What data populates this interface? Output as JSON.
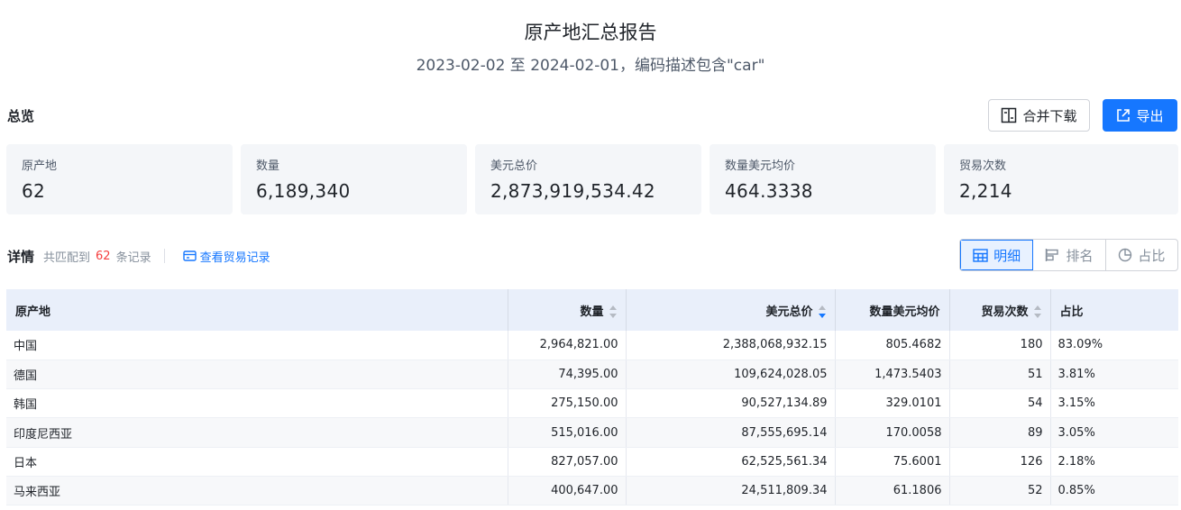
{
  "report": {
    "title": "原产地汇总报告",
    "subtitle": "2023-02-02 至 2024-02-01，编码描述包含\"car\""
  },
  "overview": {
    "title": "总览",
    "merge_download_label": "合并下载",
    "export_label": "导出",
    "cards": [
      {
        "label": "原产地",
        "value": "62"
      },
      {
        "label": "数量",
        "value": "6,189,340"
      },
      {
        "label": "美元总价",
        "value": "2,873,919,534.42"
      },
      {
        "label": "数量美元均价",
        "value": "464.3338"
      },
      {
        "label": "贸易次数",
        "value": "2,214"
      }
    ]
  },
  "details": {
    "title": "详情",
    "matched_prefix": "共匹配到",
    "matched_count": "62",
    "matched_suffix": "条记录",
    "view_trade_link": "查看贸易记录",
    "views": {
      "detail": "明细",
      "rank": "排名",
      "share": "占比"
    },
    "active_view": "明细"
  },
  "table": {
    "columns": [
      "原产地",
      "数量",
      "美元总价",
      "数量美元均价",
      "贸易次数",
      "占比"
    ],
    "sorted_column": "美元总价",
    "sort_direction": "desc",
    "rows": [
      {
        "origin": "中国",
        "qty": "2,964,821.00",
        "usd_total": "2,388,068,932.15",
        "avg": "805.4682",
        "trades": "180",
        "share": "83.09%"
      },
      {
        "origin": "德国",
        "qty": "74,395.00",
        "usd_total": "109,624,028.05",
        "avg": "1,473.5403",
        "trades": "51",
        "share": "3.81%"
      },
      {
        "origin": "韩国",
        "qty": "275,150.00",
        "usd_total": "90,527,134.89",
        "avg": "329.0101",
        "trades": "54",
        "share": "3.15%"
      },
      {
        "origin": "印度尼西亚",
        "qty": "515,016.00",
        "usd_total": "87,555,695.14",
        "avg": "170.0058",
        "trades": "89",
        "share": "3.05%"
      },
      {
        "origin": "日本",
        "qty": "827,057.00",
        "usd_total": "62,525,561.34",
        "avg": "75.6001",
        "trades": "126",
        "share": "2.18%"
      },
      {
        "origin": "马来西亚",
        "qty": "400,647.00",
        "usd_total": "24,511,809.34",
        "avg": "61.1806",
        "trades": "52",
        "share": "0.85%"
      }
    ]
  },
  "colors": {
    "primary": "#1677ff",
    "highlight_count": "#f53f3f",
    "card_bg": "#f4f6f9",
    "header_bg": "#e9effa"
  }
}
